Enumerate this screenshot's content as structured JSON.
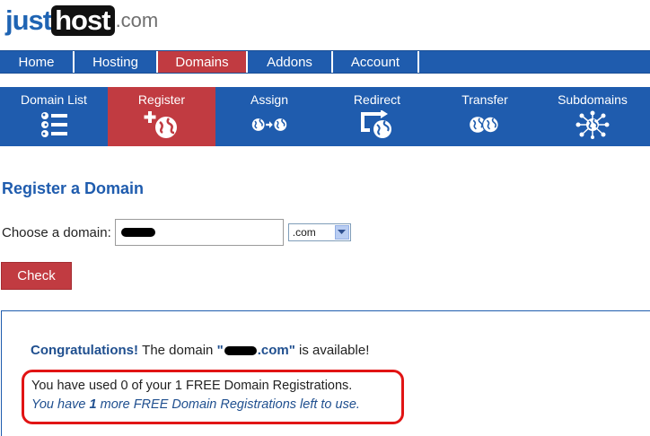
{
  "logo": {
    "part1": "just",
    "part2": "host",
    "part3": ".com"
  },
  "topnav": {
    "tabs": [
      {
        "label": "Home"
      },
      {
        "label": "Hosting"
      },
      {
        "label": "Domains"
      },
      {
        "label": "Addons"
      },
      {
        "label": "Account"
      }
    ],
    "active": "Domains"
  },
  "subnav": {
    "items": [
      {
        "label": "Domain List",
        "icon": "domain-list-icon"
      },
      {
        "label": "Register",
        "icon": "register-globe-icon"
      },
      {
        "label": "Assign",
        "icon": "assign-globes-icon"
      },
      {
        "label": "Redirect",
        "icon": "redirect-icon"
      },
      {
        "label": "Transfer",
        "icon": "transfer-globes-icon"
      },
      {
        "label": "Subdomains",
        "icon": "subdomains-network-icon"
      }
    ],
    "active": "Register"
  },
  "page": {
    "title": "Register a Domain",
    "choose_label": "Choose a domain:",
    "tld_value": ".com",
    "check_label": "Check"
  },
  "result": {
    "congrats_strong": "Congratulations!",
    "congrats_text": "The domain",
    "quote_open": "\"",
    "domain_suffix": ".com\"",
    "available_text": "is available!",
    "free_line1": "You have used 0 of your 1 FREE Domain Registrations.",
    "free_line2_pre": "You have",
    "free_line2_count": "1",
    "free_line2_post": "more FREE Domain Registrations left to use."
  },
  "colors": {
    "nav_blue": "#1f5cae",
    "active_red": "#c13b41",
    "highlight_red": "#e11414"
  }
}
